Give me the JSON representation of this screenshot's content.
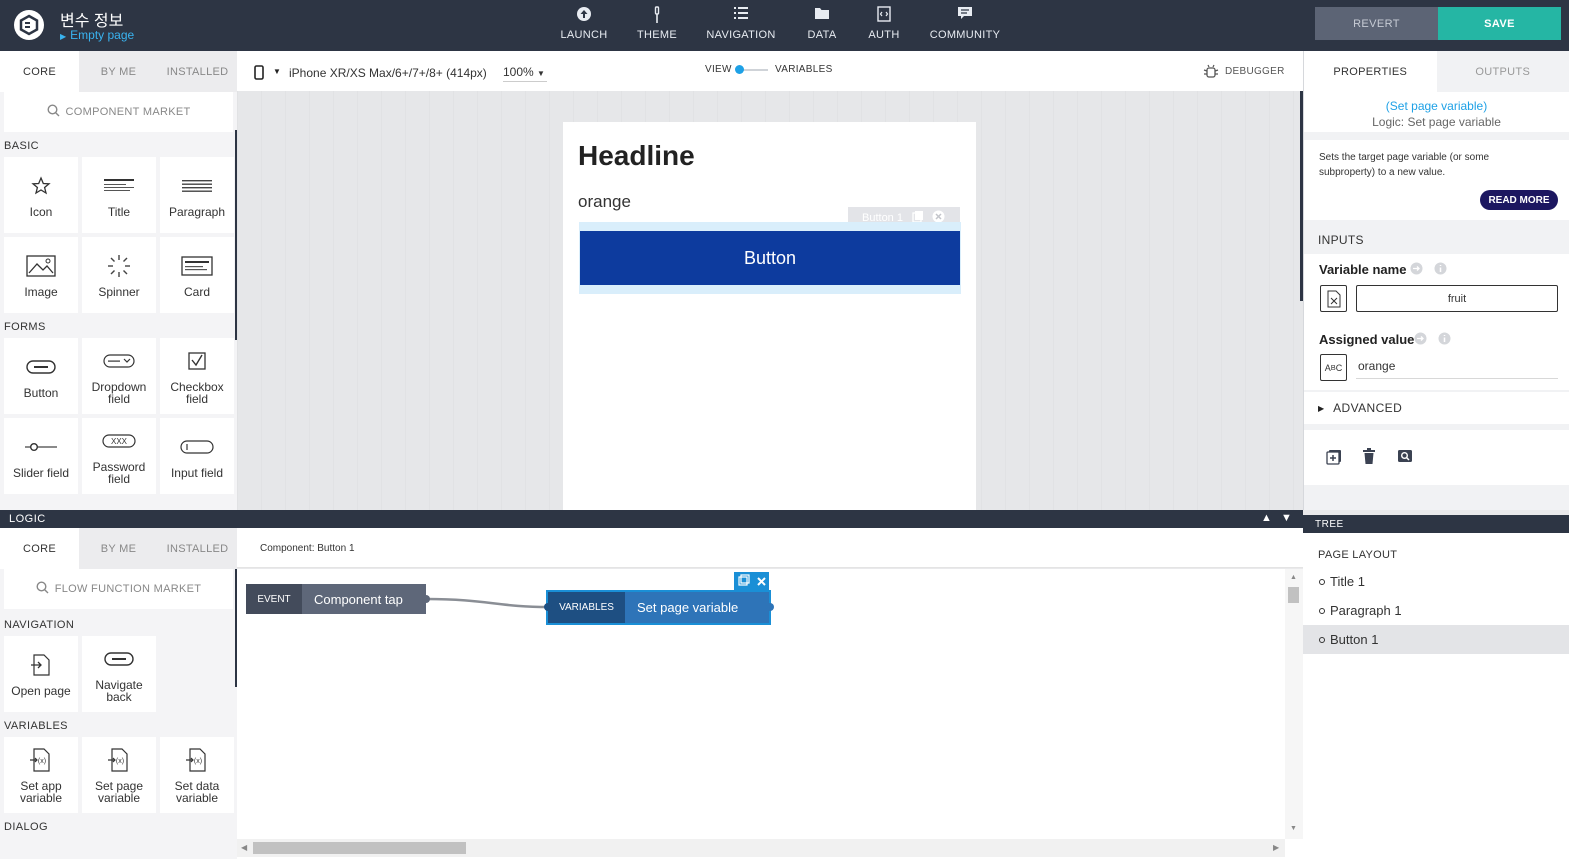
{
  "app": {
    "title": "변수 정보",
    "page_selector": "Empty page"
  },
  "top_nav": [
    {
      "label": "LAUNCH",
      "icon": "launch-icon"
    },
    {
      "label": "THEME",
      "icon": "theme-icon"
    },
    {
      "label": "NAVIGATION",
      "icon": "navigation-icon"
    },
    {
      "label": "DATA",
      "icon": "data-icon"
    },
    {
      "label": "AUTH",
      "icon": "auth-icon"
    },
    {
      "label": "COMMUNITY",
      "icon": "community-icon"
    }
  ],
  "actions": {
    "revert": "REVERT",
    "save": "SAVE"
  },
  "palette": {
    "tabs": [
      "CORE",
      "BY ME",
      "INSTALLED"
    ],
    "active_tab": "CORE",
    "market": "COMPONENT MARKET",
    "sections": [
      {
        "title": "BASIC",
        "items": [
          {
            "label": "Icon",
            "icon": "star-icon"
          },
          {
            "label": "Title",
            "icon": "title-icon"
          },
          {
            "label": "Paragraph",
            "icon": "paragraph-icon"
          },
          {
            "label": "Image",
            "icon": "image-icon"
          },
          {
            "label": "Spinner",
            "icon": "spinner-icon"
          },
          {
            "label": "Card",
            "icon": "card-icon"
          }
        ]
      },
      {
        "title": "FORMS",
        "items": [
          {
            "label": "Button",
            "icon": "button-icon"
          },
          {
            "label": "Dropdown field",
            "icon": "dropdown-icon"
          },
          {
            "label": "Checkbox field",
            "icon": "checkbox-icon"
          },
          {
            "label": "Slider field",
            "icon": "slider-icon"
          },
          {
            "label": "Password field",
            "icon": "password-icon"
          },
          {
            "label": "Input field",
            "icon": "input-icon"
          }
        ]
      }
    ]
  },
  "device_bar": {
    "device": "iPhone XR/XS Max/6+/7+/8+ (414px)",
    "zoom": "100%",
    "view_label": "VIEW",
    "variables_label": "VARIABLES",
    "debugger": "DEBUGGER"
  },
  "phone": {
    "headline": "Headline",
    "text": "orange",
    "button_label": "Button",
    "selection_tag": "Button 1"
  },
  "properties": {
    "tabs": [
      "PROPERTIES",
      "OUTPUTS"
    ],
    "active_tab": "PROPERTIES",
    "flow_name": "(Set page variable)",
    "flow_type": "Logic: Set page variable",
    "description": "Sets the target page variable (or some subproperty) to a new value.",
    "read_more": "READ MORE",
    "inputs_title": "INPUTS",
    "variable_name_label": "Variable name",
    "variable_name_value": "fruit",
    "assigned_value_label": "Assigned value",
    "assigned_value": "orange",
    "advanced": "ADVANCED"
  },
  "logic": {
    "header": "LOGIC",
    "tabs": [
      "CORE",
      "BY ME",
      "INSTALLED"
    ],
    "active_tab": "CORE",
    "market": "FLOW FUNCTION MARKET",
    "component_label": "Component: Button 1",
    "sections": [
      {
        "title": "NAVIGATION",
        "items": [
          {
            "label": "Open page",
            "icon": "open-page-icon"
          },
          {
            "label": "Navigate back",
            "icon": "navigate-back-icon"
          }
        ]
      },
      {
        "title": "VARIABLES",
        "items": [
          {
            "label": "Set app variable",
            "icon": "set-app-variable-icon"
          },
          {
            "label": "Set page variable",
            "icon": "set-page-variable-icon"
          },
          {
            "label": "Set data variable",
            "icon": "set-data-variable-icon"
          }
        ]
      },
      {
        "title": "DIALOG",
        "items": []
      }
    ],
    "nodes": [
      {
        "category": "EVENT",
        "label": "Component tap"
      },
      {
        "category": "VARIABLES",
        "label": "Set page variable"
      }
    ]
  },
  "tree": {
    "header": "TREE",
    "section": "PAGE LAYOUT",
    "items": [
      "Title 1",
      "Paragraph 1",
      "Button 1"
    ],
    "selected": "Button 1"
  },
  "colors": {
    "topbar": "#2d3544",
    "save": "#25b6a4",
    "link": "#39b3f0",
    "button_primary": "#0d3b9e",
    "flow_selected": "#1a8fd6"
  }
}
